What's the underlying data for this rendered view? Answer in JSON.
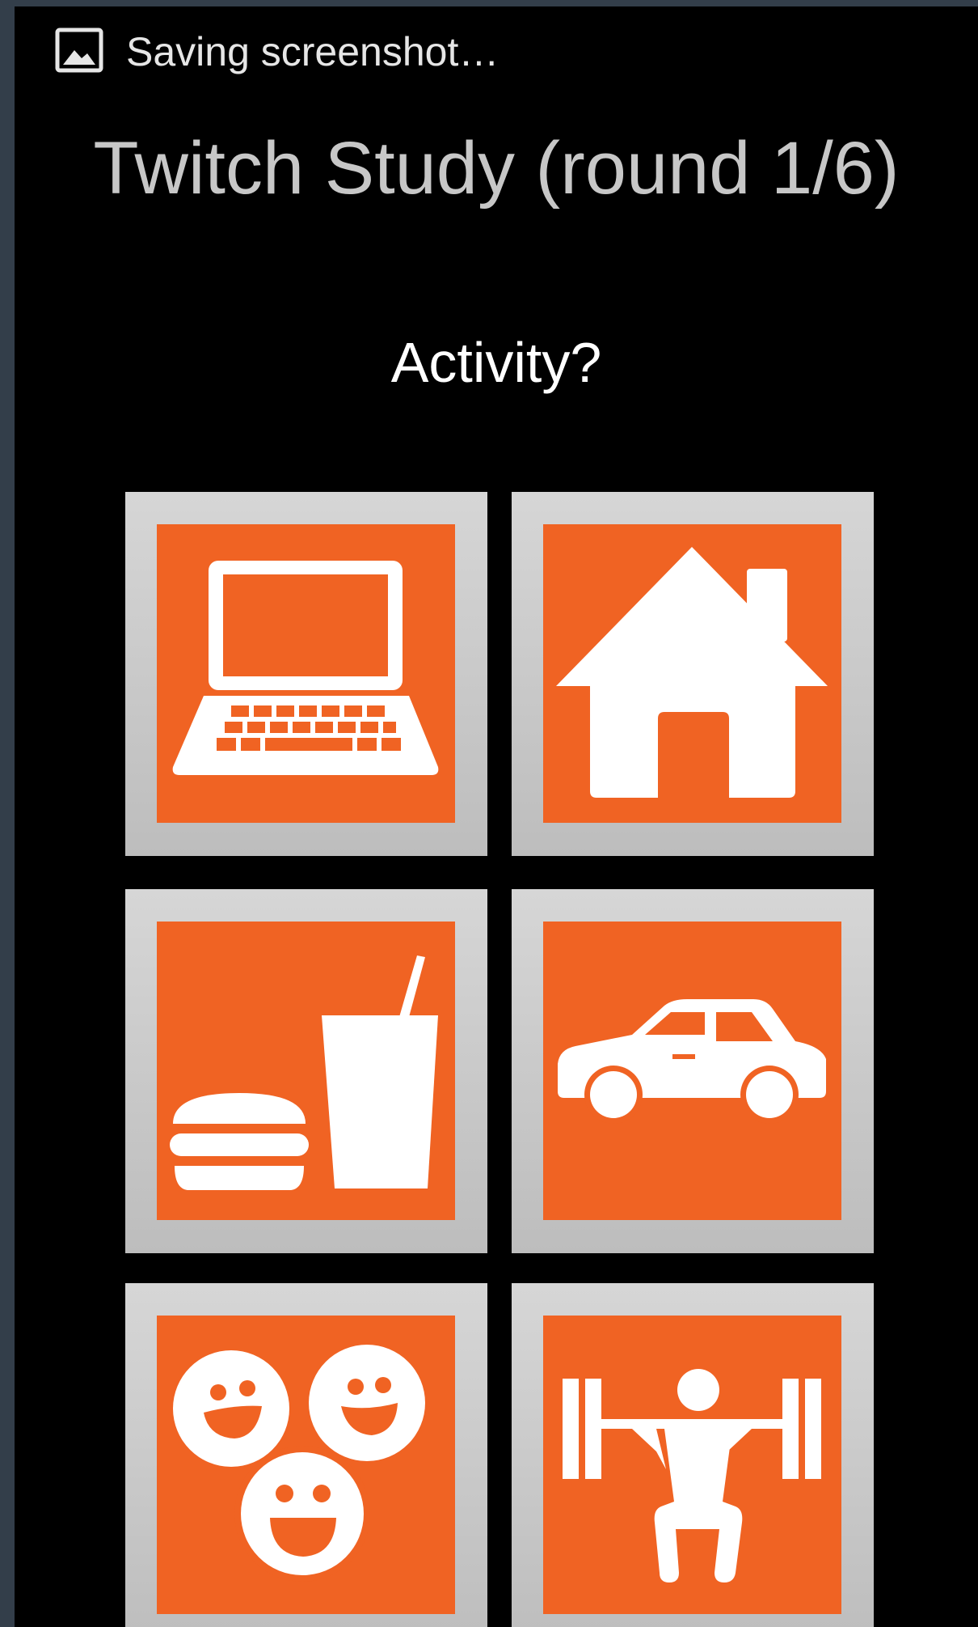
{
  "status_bar": {
    "notification_text": "Saving screenshot…",
    "notification_icon": "image-icon"
  },
  "app": {
    "title": "Twitch Study (round 1/6)",
    "question": "Activity?"
  },
  "colors": {
    "background": "#000000",
    "tile_frame": "#cccccc",
    "tile_fill": "#f06323",
    "icon": "#ffffff",
    "title_text": "#c7c7c7"
  },
  "activities": [
    {
      "id": "work",
      "icon": "laptop-icon"
    },
    {
      "id": "home",
      "icon": "house-icon"
    },
    {
      "id": "eating",
      "icon": "food-drink-icon"
    },
    {
      "id": "driving",
      "icon": "car-icon"
    },
    {
      "id": "socializing",
      "icon": "people-faces-icon"
    },
    {
      "id": "exercise",
      "icon": "weightlifting-icon"
    }
  ]
}
